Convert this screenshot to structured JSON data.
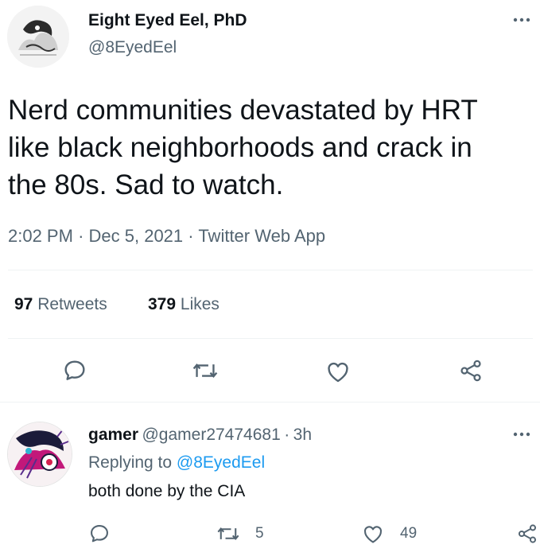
{
  "tweet": {
    "author_name": "Eight Eyed Eel, PhD",
    "author_handle": "@8EyedEel",
    "text_lines": [
      "Nerd communities devastated by HRT",
      "like black neighborhoods and crack in",
      "the 80s. Sad to watch."
    ],
    "time": "2:02 PM",
    "date": "Dec 5, 2021",
    "source": "Twitter Web App",
    "sep": "·",
    "retweets_count": "97",
    "retweets_label": "Retweets",
    "likes_count": "379",
    "likes_label": "Likes",
    "more_icon": "more-icon"
  },
  "actions": {
    "icons": [
      "reply-icon",
      "retweet-icon",
      "like-icon",
      "share-icon"
    ]
  },
  "reply": {
    "name": "gamer",
    "handle": "@gamer27474681",
    "sep": "·",
    "age": "3h",
    "replying_prefix": "Replying to",
    "replying_handle": "@8EyedEel",
    "text": "both done by the CIA",
    "retweets": "5",
    "likes": "49"
  },
  "colors": {
    "text": "#0f1419",
    "muted": "#536471",
    "link": "#1d9bf0",
    "divider": "#eff3f4"
  }
}
